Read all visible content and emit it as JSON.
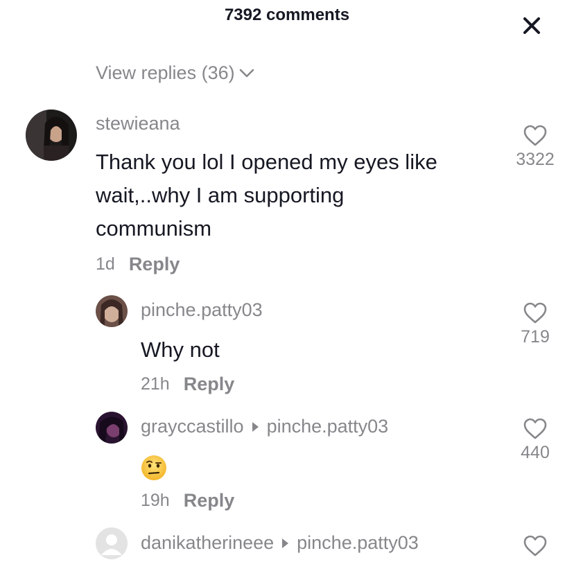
{
  "header": {
    "title": "7392 comments"
  },
  "view_replies": {
    "label": "View replies (36)"
  },
  "comments": [
    {
      "username": "stewieana",
      "text_lines": [
        "Thank you lol I opened my eyes like",
        "wait,..why I am supporting",
        "communism"
      ],
      "time": "1d",
      "reply_label": "Reply",
      "likes": "3322"
    }
  ],
  "replies": [
    {
      "username": "pinche.patty03",
      "reply_to": "",
      "text": "Why not",
      "time": "21h",
      "reply_label": "Reply",
      "likes": "719"
    },
    {
      "username": "grayccastillo",
      "reply_to": "pinche.patty03",
      "text": "🤨",
      "time": "19h",
      "reply_label": "Reply",
      "likes": "440"
    },
    {
      "username": "danikatherineee",
      "reply_to": "pinche.patty03",
      "text": "",
      "time": "",
      "reply_label": "",
      "likes": ""
    }
  ],
  "colors": {
    "primary_text": "#161823",
    "secondary_text": "#86878b",
    "background": "#ffffff"
  }
}
